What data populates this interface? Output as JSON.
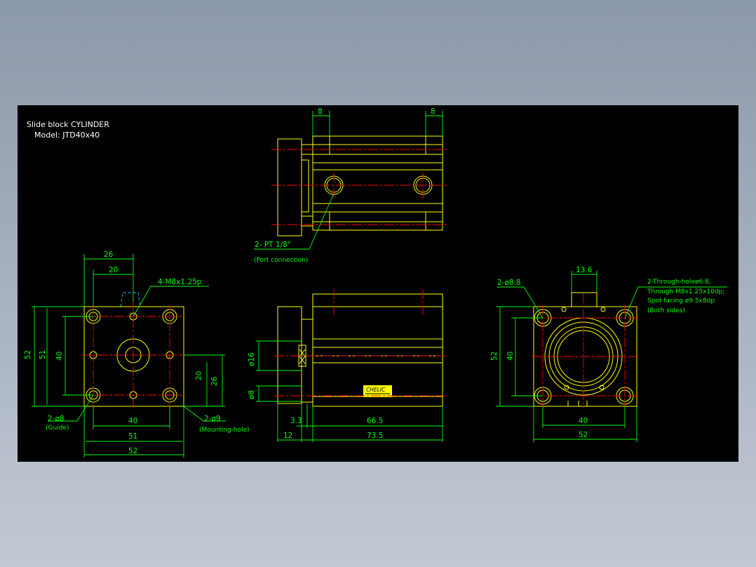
{
  "title": {
    "line1": "Slide block CYLINDER",
    "line2": "Model: JTD40x40"
  },
  "top_view": {
    "dim_left": "8",
    "dim_right": "8",
    "port_label": "2- PT 1/8\"",
    "port_note": "(Port connection)"
  },
  "left_view": {
    "dim_26_top": "26",
    "dim_20_top": "20",
    "thread_label": "4-M8x1.25p",
    "dim_52_v": "52",
    "dim_51_v": "51",
    "dim_40_v": "40",
    "dim_20_v": "20",
    "dim_26_v": "26",
    "guide_label": "2-ø8",
    "guide_note": "(Guide)",
    "mount_label": "2-ø9",
    "mount_note": "(Mounting-hole)",
    "dim_40_h": "40",
    "dim_51_h": "51",
    "dim_52_h": "52"
  },
  "front_view": {
    "dim_16": "ø16",
    "dim_8": "ø8",
    "dim_3_3": "3.3",
    "dim_66_5": "66.5",
    "dim_12": "12",
    "dim_73_5": "73.5",
    "logo_text": "CHELIC"
  },
  "right_view": {
    "dim_13_6": "13.6",
    "hole_label": "2-ø8.8",
    "through_line1": "2-Through-holeø6.8,",
    "through_line2": "Through M8x1.25x10dp;",
    "through_line3": "Spot facing ø9.5x8dp",
    "through_line4": "(Both sides)",
    "dim_52_v": "52",
    "dim_40_v": "40",
    "dim_40_h": "40",
    "dim_52_h": "52"
  },
  "colors": {
    "page_background": "#9aa5b4",
    "canvas": "#000000",
    "outline": "#ffff00",
    "dimension": "#00ff00",
    "centerline": "#ff0000",
    "hidden": "#00c8ff",
    "text": "#ffffff"
  }
}
